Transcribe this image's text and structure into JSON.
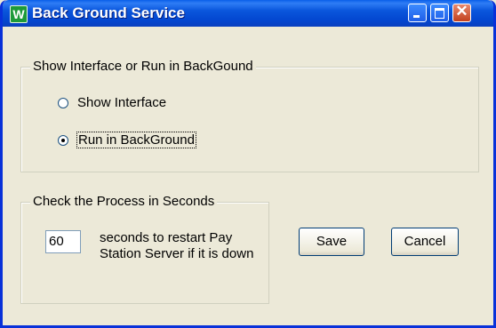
{
  "window": {
    "title": "Back Ground Service",
    "icon_letter": "W",
    "close_glyph": "✕"
  },
  "mode_group": {
    "legend": "Show Interface or Run in BackGound",
    "options": [
      {
        "label": "Show Interface",
        "selected": false
      },
      {
        "label": "Run in BackGround",
        "selected": true
      }
    ]
  },
  "process_group": {
    "legend": "Check the Process in Seconds",
    "seconds_value": "60",
    "description": "seconds to restart Pay Station Server if it is down"
  },
  "buttons": {
    "save": "Save",
    "cancel": "Cancel"
  }
}
